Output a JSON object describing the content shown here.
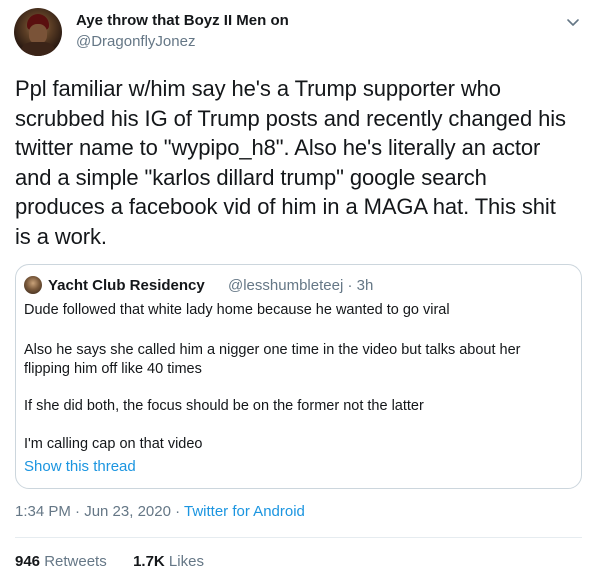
{
  "author": {
    "display_name": "Aye throw that Boyz II Men on",
    "handle": "@DragonflyJonez"
  },
  "tweet": {
    "line1": "Ppl familiar w/him say he's a Trump supporter who",
    "line2": "scrubbed his IG of Trump posts and recently changed his",
    "line3": "twitter name to \"wypipo_h8\". Also he's literally an actor",
    "line4": "and a simple \"karlos dillard trump\" google search",
    "line5": "produces a facebook vid of him in a MAGA hat. This shit",
    "line6": "is a work."
  },
  "quoted": {
    "display_name": "Yacht Club Residency",
    "handle_time": "@lesshumbleteej · 3h",
    "p1": "Dude followed that white lady home because he wanted to go viral",
    "p2_line1": "Also he says she called him a nigger one time in the video but talks about her",
    "p2_line2": "flipping him off like 40 times",
    "p3": "If she did both, the focus should be on the former not the latter",
    "p4": "I'm calling cap on that video",
    "show_thread": "Show this thread"
  },
  "meta": {
    "datetime": "1:34 PM · Jun 23, 2020 · ",
    "source": "Twitter for Android"
  },
  "stats": {
    "retweets_count": "946",
    "retweets_label": " Retweets",
    "likes_count": "1.7K",
    "likes_label": " Likes"
  },
  "icons": {
    "caret": "chevron-down-icon"
  },
  "colors": {
    "text": "#14171a",
    "secondary": "#657786",
    "link": "#1b95e0",
    "border": "#ccd6dd"
  }
}
